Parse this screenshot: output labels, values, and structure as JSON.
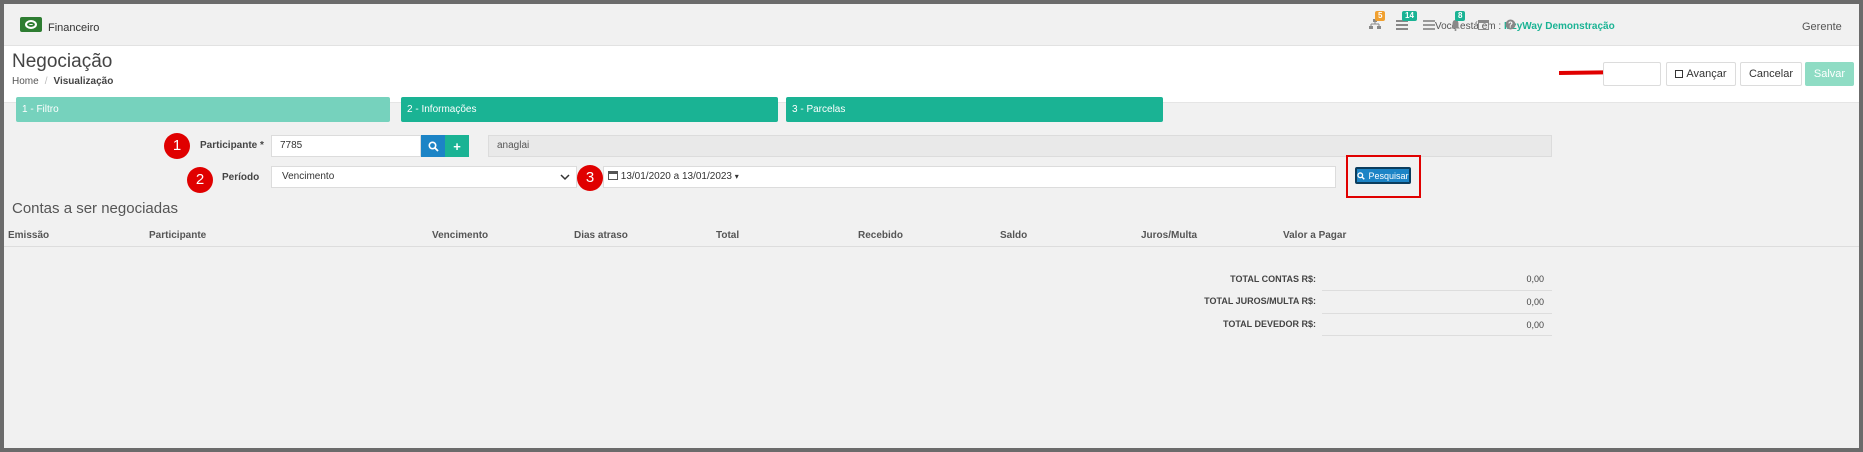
{
  "topbar": {
    "app_name": "Financeiro",
    "you_are_prefix": "Você está em :",
    "company": "IzzyWay Demonstração",
    "badges": [
      "5",
      "14",
      "8"
    ],
    "user": "Gerente"
  },
  "header": {
    "title": "Negociação",
    "breadcrumb": [
      "Home",
      "Visualização"
    ],
    "buttons": {
      "avancar": "Avançar",
      "cancelar": "Cancelar",
      "salvar": "Salvar"
    }
  },
  "steps": [
    "1 - Filtro",
    "2 - Informações",
    "3 - Parcelas"
  ],
  "form": {
    "participante_label": "Participante *",
    "participante_value": "7785",
    "participante_name": "anaglai",
    "periodo_label": "Período",
    "periodo_value": "Vencimento",
    "date_range": "13/01/2020 a 13/01/2023",
    "search_button": "Pesquisar",
    "markers": [
      "1",
      "2",
      "3"
    ]
  },
  "table": {
    "title": "Contas a ser negociadas",
    "columns": [
      "Emissão",
      "Participante",
      "Vencimento",
      "Dias atraso",
      "Total",
      "Recebido",
      "Saldo",
      "Juros/Multa",
      "Valor a Pagar"
    ]
  },
  "totals": [
    {
      "label": "TOTAL CONTAS R$:",
      "value": "0,00"
    },
    {
      "label": "TOTAL JUROS/MULTA R$:",
      "value": "0,00"
    },
    {
      "label": "TOTAL DEVEDOR R$:",
      "value": "0,00"
    }
  ],
  "colors": {
    "accent": "#1ab394",
    "accent_light": "#76d2bd",
    "primary": "#1c84c6",
    "annotation": "#e00000"
  }
}
